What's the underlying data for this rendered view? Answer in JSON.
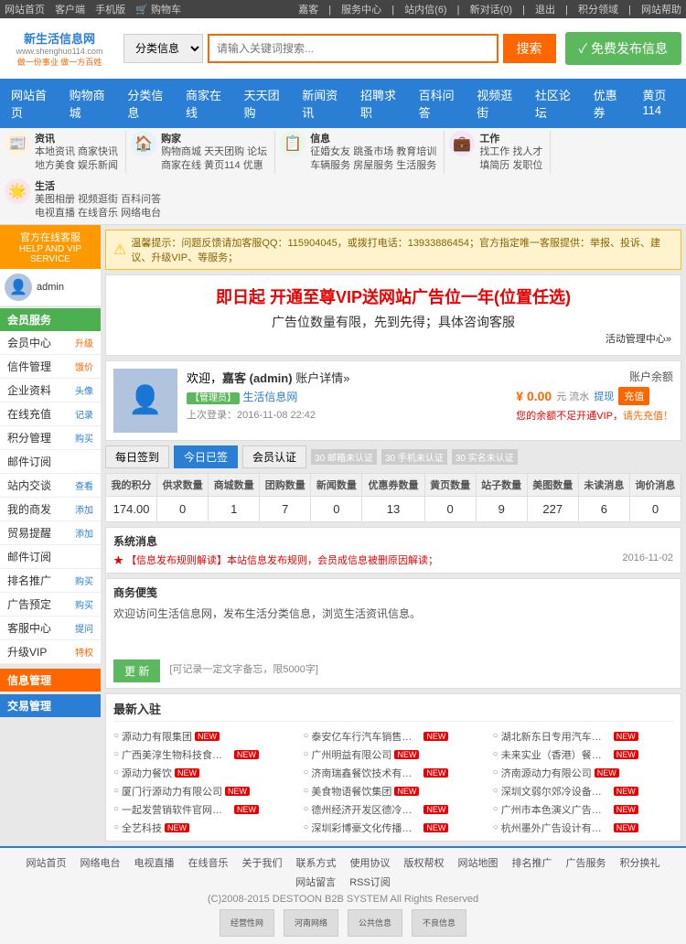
{
  "topbar": {
    "left_links": [
      "网站首页",
      "客户端",
      "手机版",
      "购物车"
    ],
    "right_links": [
      "服务中心",
      "站内信(6)",
      "新对话(0)",
      "退出",
      "积分领域",
      "网站帮助"
    ]
  },
  "header": {
    "logo_title": "新生活信息网",
    "logo_url": "www.shenghuo114.com",
    "logo_sub": "做一份事业  做一方百姓",
    "search_placeholder": "请输入关键词搜索...",
    "search_label": "搜索",
    "search_category": "分类信息",
    "publish_btn": "✓ 免费发布信息"
  },
  "mainnav": {
    "items": [
      "网站首页",
      "购物商城",
      "分类信息",
      "商家在线",
      "天天团购",
      "新闻资讯",
      "招聘求职",
      "百科问答",
      "视频逛街",
      "社区论坛",
      "优惠券",
      "黄页114"
    ]
  },
  "subnav": {
    "sections": [
      {
        "icon": "📰",
        "color": "#f60",
        "label": "资讯",
        "links": [
          "本地资讯",
          "商家快讯",
          "地方美食",
          "娱乐新闻"
        ]
      },
      {
        "icon": "🏠",
        "color": "#2a7fd4",
        "label": "购家",
        "links": [
          "购物商城",
          "天天团购",
          "论坛",
          "商家在线",
          "黄页114",
          "优惠"
        ]
      },
      {
        "icon": "📋",
        "color": "#5cb85c",
        "label": "信息",
        "links": [
          "征婚女友",
          "跳蚤市场",
          "教育培训",
          "车辆服务",
          "房屋服务",
          "生活服务"
        ]
      },
      {
        "icon": "💼",
        "color": "#9c27b0",
        "label": "工作",
        "links": [
          "找工作",
          "找人才",
          "填简历",
          "发职位"
        ]
      },
      {
        "icon": "🌟",
        "color": "#e91e63",
        "label": "生活",
        "links": [
          "美图相册",
          "视频逛街",
          "百科问答",
          "电视直播",
          "在线音乐",
          "网络电台"
        ]
      }
    ]
  },
  "sidebar": {
    "online_service": "官方在线客服",
    "service_sub": "HELP AND VIP SERVICE",
    "sections": [
      {
        "label": "会员服务",
        "color": "green",
        "items": [
          {
            "label": "会员中心",
            "action": "升级",
            "action_color": "orange"
          },
          {
            "label": "信件管理",
            "action": "饿价",
            "action_color": "orange"
          },
          {
            "label": "企业资料",
            "action": "头像",
            "action_color": "blue"
          },
          {
            "label": "在线充值",
            "action": "记录",
            "action_color": "blue"
          },
          {
            "label": "积分管理",
            "action": "购买",
            "action_color": "blue"
          },
          {
            "label": "邮件订阅",
            "action": "",
            "action_color": ""
          },
          {
            "label": "站内交谈",
            "action": "查看",
            "action_color": "blue"
          },
          {
            "label": "我的商发",
            "action": "添加",
            "action_color": "blue"
          },
          {
            "label": "贸易提醒",
            "action": "添加",
            "action_color": "blue"
          },
          {
            "label": "邮件订阅",
            "action": "",
            "action_color": ""
          },
          {
            "label": "排名推广",
            "action": "购买",
            "action_color": "blue"
          },
          {
            "label": "广告预定",
            "action": "购买",
            "action_color": "blue"
          },
          {
            "label": "客服中心",
            "action": "提问",
            "action_color": "blue"
          },
          {
            "label": "升级VIP",
            "action": "特权",
            "action_color": "orange"
          }
        ]
      },
      {
        "label": "信息管理",
        "color": "orange",
        "items": []
      },
      {
        "label": "交易管理",
        "color": "blue",
        "items": []
      }
    ]
  },
  "notice": {
    "text": "温馨提示：问题反馈请加客服QQ：115904045，或拨打电话：13933886454；官方指定唯一客服提供：举报、投诉、建议、升级VIP、等服务；"
  },
  "promo": {
    "title": "即日起 开通至尊VIP送网站广告位一年(位置任选)",
    "subtitle": "广告位数量有限，先到先得；具体咨询客服",
    "corner_link": "活动管理中心»"
  },
  "user": {
    "welcome": "欢迎，嘉客 (admin)",
    "profile_link": "账户详情»",
    "tag": "管理员",
    "company": "生活信息网",
    "last_login": "上次登录：2016-11-08 22:42",
    "balance_label": "账户余额",
    "balance": "¥ 0.00",
    "balance_unit": "元 流水",
    "withdraw_label": "提现",
    "recharge_label": "充值",
    "vip_warning": "您的余额不足开通VIP，请先充值！"
  },
  "checkin": {
    "daily_label": "每日签到",
    "today_label": "今日已签",
    "verify_label": "会员认证",
    "badges": [
      {
        "label": "30 邮箱未认证",
        "done": false
      },
      {
        "label": "30 手机未认证",
        "done": false
      },
      {
        "label": "30 实名未认证",
        "done": false
      }
    ]
  },
  "stats": {
    "headers": [
      "我的积分",
      "供求数量",
      "商城数量",
      "团购数量",
      "新闻数量",
      "优惠券数量",
      "黄页数量",
      "站子数量",
      "美图数量",
      "未读消息",
      "询价消息"
    ],
    "values": [
      "174.00",
      "0",
      "1",
      "7",
      "0",
      "13",
      "0",
      "9",
      "227",
      "6",
      "0"
    ]
  },
  "sysmsg": {
    "title": "系统消息",
    "items": [
      {
        "text": "【信息发布规则解读】本站信息发布规则，会员成信息被删原因解读；",
        "date": "2016-11-02",
        "is_link": true
      }
    ]
  },
  "bizpad": {
    "title": "商务便笺",
    "content": "欢迎访问生活信息网，发布生活分类信息，浏览生活资讯信息。",
    "btn_label": "更 新",
    "hint": "[可记录一定文字备忘，限5000字]"
  },
  "latest": {
    "title": "最新入驻",
    "companies": [
      {
        "name": "源动力有限集团",
        "new": true
      },
      {
        "name": "泰安亿车行汽车销售服务有",
        "new": true
      },
      {
        "name": "湖北新东日专用汽车有限公",
        "new": true
      },
      {
        "name": "广西美淳生物科技食品有限",
        "new": true
      },
      {
        "name": "广州明益有限公司",
        "new": true
      },
      {
        "name": "未来实业（香港）餐饮集团",
        "new": true
      },
      {
        "name": "源动力餐饮",
        "new": true
      },
      {
        "name": "济南瑞鑫餐饮技术有限公司",
        "new": true
      },
      {
        "name": "济南源动力有限公司",
        "new": true
      },
      {
        "name": "厦门行源动力有限公司",
        "new": true
      },
      {
        "name": "美食物语餐饮集团",
        "new": true
      },
      {
        "name": "深圳文弱尔郊冷设备有限公",
        "new": true
      },
      {
        "name": "一起发营销软件官网一起发",
        "new": true
      },
      {
        "name": "德州经济开发区德冷空调",
        "new": true
      },
      {
        "name": "广州市本色演义广告有限公",
        "new": true
      },
      {
        "name": "全艺科技",
        "new": true
      },
      {
        "name": "深圳彩博豪文化传播有限公",
        "new": true
      },
      {
        "name": "杭州墨外广告设计有限公司",
        "new": true
      }
    ]
  },
  "footer": {
    "nav": [
      "网站首页",
      "网络电台",
      "电视直播",
      "在线音乐",
      "关于我们",
      "联系方式",
      "使用协议",
      "版权帮权",
      "网站地图",
      "排名推广",
      "广告服务",
      "积分换礼",
      "网站留言",
      "RSS订阅"
    ],
    "copyright": "(C)2008-2015 DESTOON B2B SYSTEM All Rights Reserved",
    "badges": [
      "经营性网",
      "河南网络",
      "公共信息",
      "不良信息"
    ]
  }
}
